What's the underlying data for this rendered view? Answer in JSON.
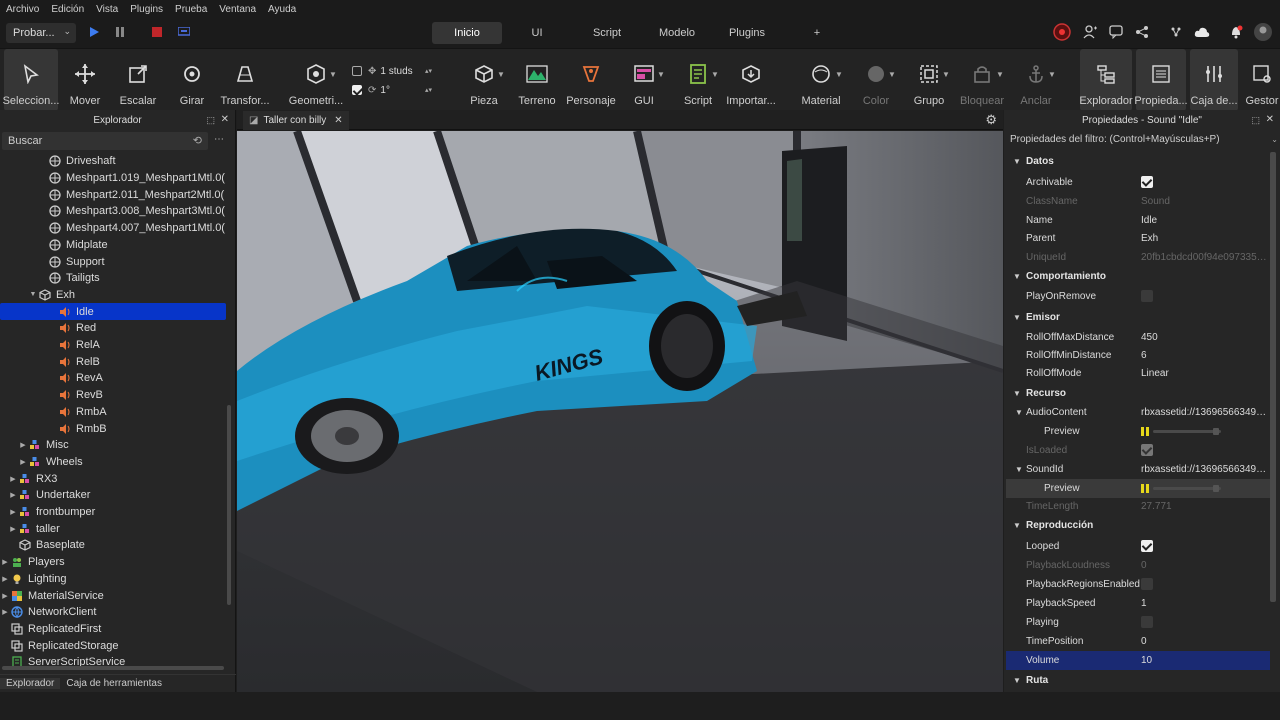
{
  "menubar": [
    "Archivo",
    "Edición",
    "Vista",
    "Plugins",
    "Prueba",
    "Ventana",
    "Ayuda"
  ],
  "toolbar": {
    "play_mode": "Probar..."
  },
  "nav_tabs": [
    "Inicio",
    "UI",
    "Script",
    "Modelo",
    "Plugins",
    "+"
  ],
  "ribbon": {
    "select": "Seleccion...",
    "move": "Mover",
    "scale": "Escalar",
    "rotate": "Girar",
    "transform": "Transfor...",
    "geometry": "Geometri...",
    "studs": "1 studs",
    "angle": "1°",
    "part": "Pieza",
    "terrain": "Terreno",
    "character": "Personaje",
    "gui": "GUI",
    "script": "Script",
    "import": "Importar...",
    "material": "Material",
    "color": "Color",
    "group": "Grupo",
    "lock": "Bloquear",
    "anchor": "Anclar",
    "explorer": "Explorador",
    "properties": "Propieda...",
    "toolbox": "Caja de...",
    "manager": "Gestor"
  },
  "explorer": {
    "title": "Explorador",
    "search_placeholder": "Buscar",
    "items": [
      {
        "label": "Driveshaft",
        "icon": "meshpart-icon"
      },
      {
        "label": "Meshpart1.019_Meshpart1Mtl.0(",
        "icon": "meshpart-icon"
      },
      {
        "label": "Meshpart2.011_Meshpart2Mtl.0(",
        "icon": "meshpart-icon"
      },
      {
        "label": "Meshpart3.008_Meshpart3Mtl.0(",
        "icon": "meshpart-icon"
      },
      {
        "label": "Meshpart4.007_Meshpart1Mtl.0(",
        "icon": "meshpart-icon"
      },
      {
        "label": "Midplate",
        "icon": "meshpart-icon"
      },
      {
        "label": "Support",
        "icon": "meshpart-icon"
      },
      {
        "label": "Tailigts",
        "icon": "meshpart-icon"
      },
      {
        "label": "Exh",
        "icon": "part-icon"
      },
      {
        "label": "Idle",
        "icon": "sound-icon"
      },
      {
        "label": "Red",
        "icon": "sound-icon"
      },
      {
        "label": "RelA",
        "icon": "sound-icon"
      },
      {
        "label": "RelB",
        "icon": "sound-icon"
      },
      {
        "label": "RevA",
        "icon": "sound-icon"
      },
      {
        "label": "RevB",
        "icon": "sound-icon"
      },
      {
        "label": "RmbA",
        "icon": "sound-icon"
      },
      {
        "label": "RmbB",
        "icon": "sound-icon"
      },
      {
        "label": "Misc",
        "icon": "model-icon"
      },
      {
        "label": "Wheels",
        "icon": "model-icon"
      },
      {
        "label": "RX3",
        "icon": "model-icon"
      },
      {
        "label": "Undertaker",
        "icon": "model-icon"
      },
      {
        "label": "frontbumper",
        "icon": "model-icon"
      },
      {
        "label": "taller",
        "icon": "model-icon"
      },
      {
        "label": "Baseplate",
        "icon": "part-icon"
      },
      {
        "label": "Players",
        "icon": "players-icon"
      },
      {
        "label": "Lighting",
        "icon": "lighting-icon"
      },
      {
        "label": "MaterialService",
        "icon": "material-service-icon"
      },
      {
        "label": "NetworkClient",
        "icon": "network-icon"
      },
      {
        "label": "ReplicatedFirst",
        "icon": "replicated-icon"
      },
      {
        "label": "ReplicatedStorage",
        "icon": "replicated-icon"
      },
      {
        "label": "ServerScriptService",
        "icon": "server-script-icon"
      }
    ],
    "bottom_tabs": [
      "Explorador",
      "Caja de herramientas"
    ]
  },
  "viewport": {
    "tab_label": "Taller con billy",
    "decal_text": "KINGS"
  },
  "properties": {
    "title": "Propiedades - Sound \"Idle\"",
    "filter_placeholder": "Propiedades del filtro: (Control+Mayúsculas+P)",
    "rows": [
      {
        "type": "cat",
        "name": "Datos"
      },
      {
        "type": "prop",
        "name": "Archivable",
        "check": "on"
      },
      {
        "type": "prop",
        "name": "ClassName",
        "value": "Sound",
        "dim": true
      },
      {
        "type": "prop",
        "name": "Name",
        "value": "Idle"
      },
      {
        "type": "prop",
        "name": "Parent",
        "value": "Exh"
      },
      {
        "type": "prop",
        "name": "UniqueId",
        "value": "20fb1cbdcd00f94e0973357...",
        "dim": true
      },
      {
        "type": "cat",
        "name": "Comportamiento"
      },
      {
        "type": "prop",
        "name": "PlayOnRemove",
        "check": "off"
      },
      {
        "type": "cat",
        "name": "Emisor"
      },
      {
        "type": "prop",
        "name": "RollOffMaxDistance",
        "value": "450"
      },
      {
        "type": "prop",
        "name": "RollOffMinDistance",
        "value": "6"
      },
      {
        "type": "prop",
        "name": "RollOffMode",
        "value": "Linear"
      },
      {
        "type": "cat",
        "name": "Recurso"
      },
      {
        "type": "expand",
        "name": "AudioContent",
        "value": "rbxassetid://136965663496..."
      },
      {
        "type": "sub",
        "name": "Preview",
        "slider": true
      },
      {
        "type": "prop",
        "name": "IsLoaded",
        "check": "dimon",
        "dim": true
      },
      {
        "type": "expand",
        "name": "SoundId",
        "value": "rbxassetid://136965663496..."
      },
      {
        "type": "sub",
        "name": "Preview",
        "slider": true,
        "hover": true
      },
      {
        "type": "prop",
        "name": "TimeLength",
        "value": "27.771",
        "dim": true
      },
      {
        "type": "cat",
        "name": "Reproducción"
      },
      {
        "type": "prop",
        "name": "Looped",
        "check": "on"
      },
      {
        "type": "prop",
        "name": "PlaybackLoudness",
        "value": "0",
        "dim": true
      },
      {
        "type": "prop",
        "name": "PlaybackRegionsEnabled",
        "check": "off"
      },
      {
        "type": "prop",
        "name": "PlaybackSpeed",
        "value": "1"
      },
      {
        "type": "prop",
        "name": "Playing",
        "check": "off"
      },
      {
        "type": "prop",
        "name": "TimePosition",
        "value": "0"
      },
      {
        "type": "prop",
        "name": "Volume",
        "value": "10",
        "highlight": true
      },
      {
        "type": "cat",
        "name": "Ruta"
      }
    ]
  },
  "colors": {
    "selection": "#0735c9",
    "sound_icon": "#e8743b",
    "accent_yellow": "#e6d81a",
    "car_body": "#1e9fd0"
  }
}
